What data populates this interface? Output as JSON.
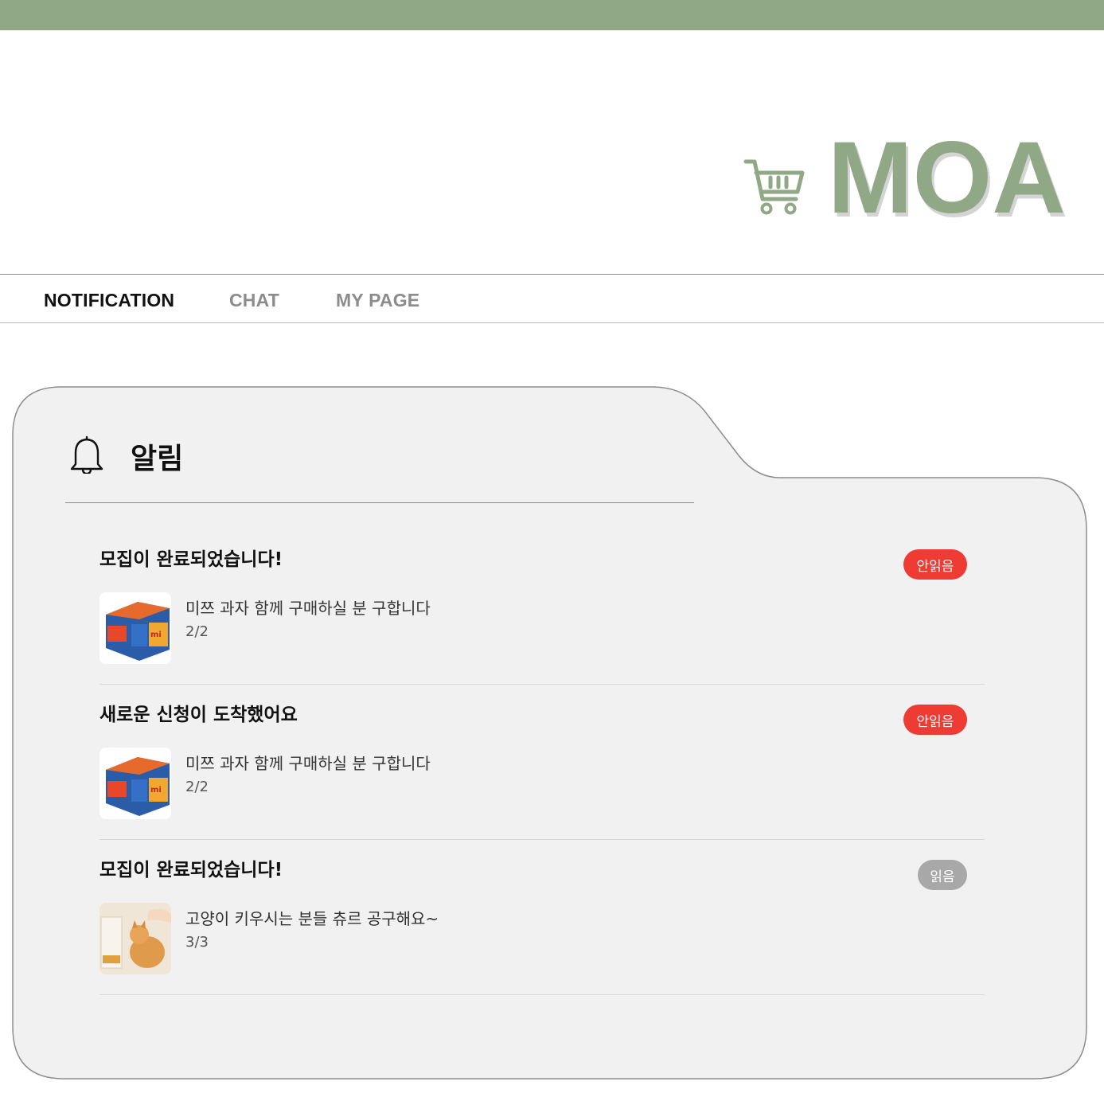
{
  "brand": {
    "logo_text": "MOA",
    "accent_color": "#91a887"
  },
  "nav": {
    "items": [
      {
        "label": "NOTIFICATION",
        "active": true
      },
      {
        "label": "CHAT",
        "active": false
      },
      {
        "label": "MY PAGE",
        "active": false
      }
    ]
  },
  "panel": {
    "title": "알림",
    "icon": "bell-icon"
  },
  "notifications": [
    {
      "title": "모집이 완료되었습니다!",
      "post_title": "미쯔 과자 함께 구매하실 분 구합니다",
      "count": "2/2",
      "status": "안읽음",
      "thumbnail": "snack-box-image"
    },
    {
      "title": "새로운 신청이 도착했어요",
      "post_title": "미쯔 과자 함께 구매하실 분 구합니다",
      "count": "2/2",
      "status": "안읽음",
      "thumbnail": "snack-box-image"
    },
    {
      "title": "모집이 완료되었습니다!",
      "post_title": "고양이 키우시는 분들 츄르 공구해요~",
      "count": "3/3",
      "status": "읽음",
      "thumbnail": "cat-treat-image"
    }
  ],
  "colors": {
    "unread_badge": "#ee3b34",
    "read_badge": "#a8a8a8",
    "panel_bg": "#f1f1f1"
  }
}
